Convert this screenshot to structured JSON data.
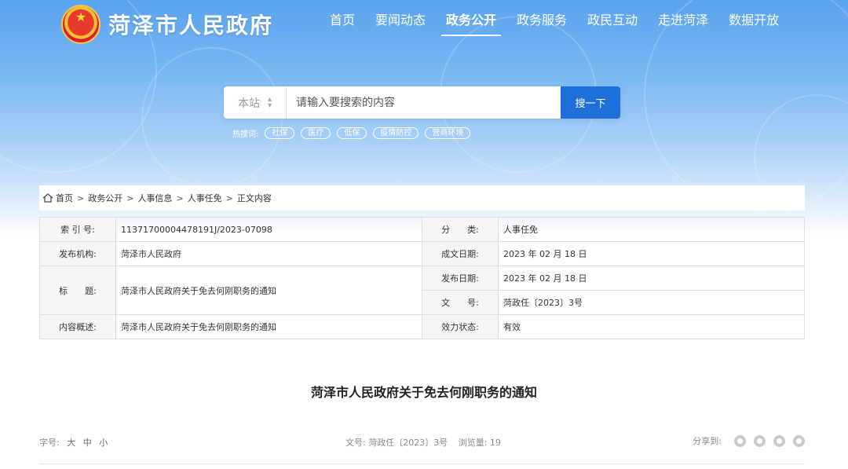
{
  "site": {
    "name": "菏泽市人民政府"
  },
  "nav": [
    {
      "label": "首页"
    },
    {
      "label": "要闻动态"
    },
    {
      "label": "政务公开"
    },
    {
      "label": "政务服务"
    },
    {
      "label": "政民互动"
    },
    {
      "label": "走进菏泽"
    },
    {
      "label": "数据开放"
    }
  ],
  "search": {
    "scope": "本站",
    "placeholder": "请输入要搜索的内容",
    "button": "搜一下"
  },
  "hot": {
    "label": "热搜词:",
    "tags": [
      "社保",
      "医疗",
      "低保",
      "疫情防控",
      "营商环境"
    ]
  },
  "breadcrumb": [
    "首页",
    "政务公开",
    "人事信息",
    "人事任免",
    "正文内容"
  ],
  "info": {
    "index_label": "索 引 号:",
    "index_value": "11371700004478191J/2023-07098",
    "category_label": "分　　类:",
    "category_value": "人事任免",
    "publisher_label": "发布机构:",
    "publisher_value": "菏泽市人民政府",
    "created_label": "成文日期:",
    "created_value": "2023 年 02 月 18 日",
    "title_label": "标　　题:",
    "title_value": "菏泽市人民政府关于免去何刚职务的通知",
    "published_label": "发布日期:",
    "published_value": "2023 年 02 月 18 日",
    "docno_label": "文　　号:",
    "docno_value": "菏政任〔2023〕3号",
    "summary_label": "内容概述:",
    "summary_value": "菏泽市人民政府关于免去何刚职务的通知",
    "status_label": "效力状态:",
    "status_value": "有效"
  },
  "article": {
    "title": "菏泽市人民政府关于免去何刚职务的通知",
    "font_label": "字号:",
    "font_large": "大",
    "font_medium": "中",
    "font_small": "小",
    "docno": "文号: 菏政任〔2023〕3号",
    "views": "浏览量: 19",
    "share_label": "分享到:"
  }
}
